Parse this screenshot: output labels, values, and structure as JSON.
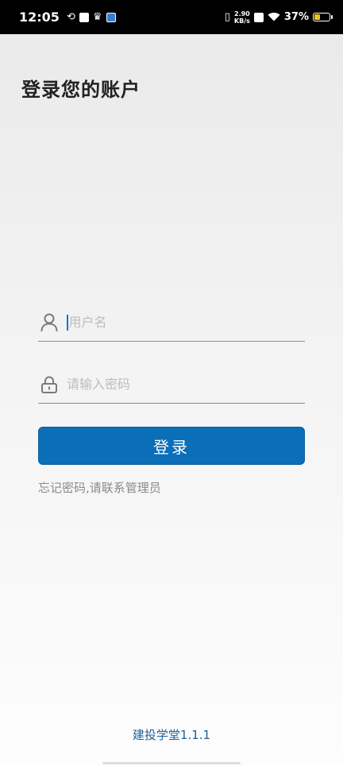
{
  "status_bar": {
    "time": "12:05",
    "net_speed_value": "2.90",
    "net_speed_unit": "KB/s",
    "battery_percent": "37%",
    "battery_level": 0.37,
    "battery_color": "#f0c419"
  },
  "page": {
    "title": "登录您的账户"
  },
  "form": {
    "username": {
      "value": "",
      "placeholder": "用户名",
      "icon": "user-icon"
    },
    "password": {
      "value": "",
      "placeholder": "请输入密码",
      "icon": "lock-icon"
    },
    "login_label": "登录",
    "forgot_text": "忘记密码,请联系管理员"
  },
  "footer": {
    "version": "建投学堂1.1.1"
  },
  "colors": {
    "primary": "#0b6eb9",
    "version_text": "#1d5f99"
  }
}
